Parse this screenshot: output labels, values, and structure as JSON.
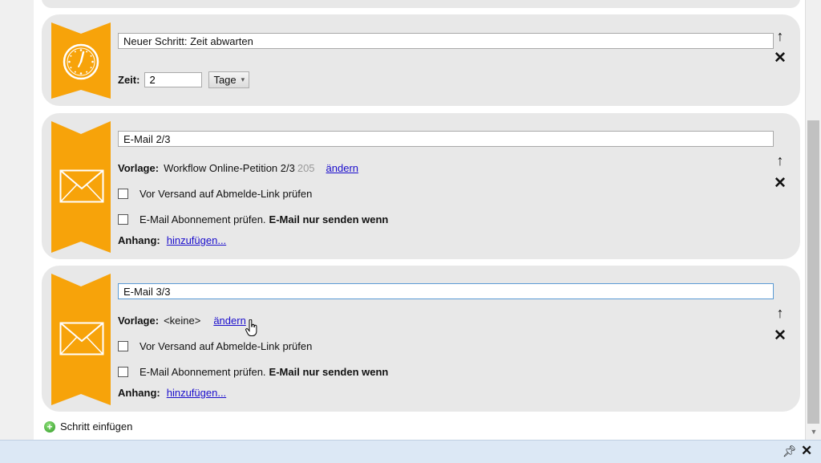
{
  "steps": [
    {
      "type": "wait",
      "icon": "clock-icon",
      "title": "Neuer Schritt: Zeit abwarten",
      "zeit_label": "Zeit:",
      "zeit_value": "2",
      "unit": "Tage"
    },
    {
      "type": "email",
      "icon": "envelope-icon",
      "title": "E-Mail 2/3",
      "vorlage_label": "Vorlage:",
      "vorlage_value": "Workflow Online-Petition 2/3",
      "vorlage_id": "205",
      "change_link": "ändern",
      "check1": "Vor Versand auf Abmelde-Link prüfen",
      "check2_prefix": "E-Mail Abonnement prüfen.",
      "check2_bold": "E-Mail nur senden wenn",
      "anhang_label": "Anhang:",
      "anhang_link": "hinzufügen..."
    },
    {
      "type": "email",
      "icon": "envelope-icon",
      "title": "E-Mail 3/3",
      "vorlage_label": "Vorlage:",
      "vorlage_value": "<keine>",
      "change_link": "ändern",
      "check1": "Vor Versand auf Abmelde-Link prüfen",
      "check2_prefix": "E-Mail Abonnement prüfen.",
      "check2_bold": "E-Mail nur senden wenn",
      "anhang_label": "Anhang:",
      "anhang_link": "hinzufügen..."
    }
  ],
  "controls": {
    "move_up": "↑",
    "delete": "✕"
  },
  "add_step_label": "Schritt einfügen",
  "colors": {
    "accent": "#f7a30a",
    "card_bg": "#e8e8e8",
    "link": "#1a0dcc",
    "focus_border": "#5b9bd5"
  },
  "bottom_bar": {
    "pin_icon": "pin-icon",
    "close_icon": "close-icon"
  }
}
